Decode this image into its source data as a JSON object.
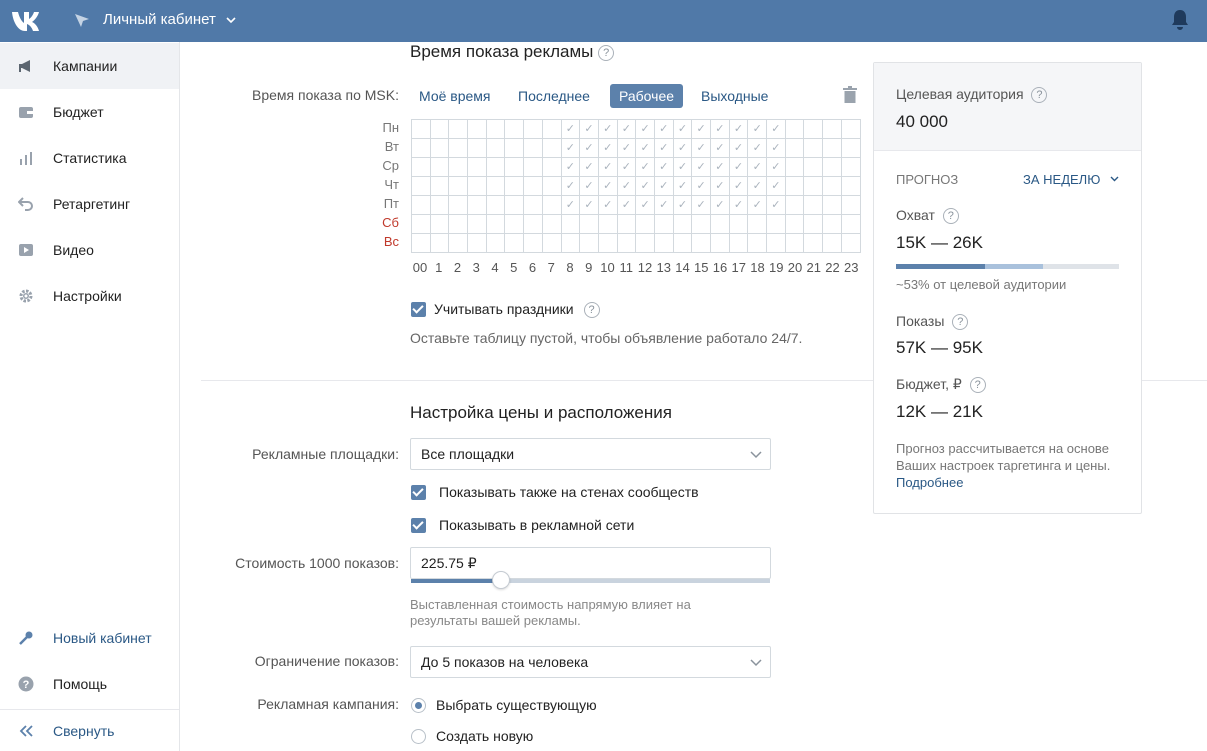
{
  "topbar": {
    "title": "Личный кабинет",
    "logo_icon": "vk-logo-icon",
    "bell_icon": "bell-icon",
    "color": "#5079a8"
  },
  "sidebar": {
    "items": [
      {
        "label": "Кампании",
        "icon": "megaphone-icon",
        "active": true
      },
      {
        "label": "Бюджет",
        "icon": "wallet-icon"
      },
      {
        "label": "Статистика",
        "icon": "bar-chart-icon"
      },
      {
        "label": "Ретаргетинг",
        "icon": "return-arrow-icon"
      },
      {
        "label": "Видео",
        "icon": "play-icon"
      },
      {
        "label": "Настройки",
        "icon": "gear-icon"
      }
    ],
    "bottom": [
      {
        "label": "Новый кабинет",
        "icon": "key-icon"
      },
      {
        "label": "Помощь",
        "icon": "help-icon"
      },
      {
        "label": "Свернуть",
        "icon": "collapse-icon"
      }
    ]
  },
  "schedule": {
    "title": "Время показа рекламы",
    "label": "Время показа по MSK:",
    "tabs": [
      "Моё время",
      "Последнее",
      "Рабочее",
      "Выходные"
    ],
    "active_tab": "Рабочее",
    "days": [
      "Пн",
      "Вт",
      "Ср",
      "Чт",
      "Пт",
      "Сб",
      "Вс"
    ],
    "hours": [
      "00",
      "1",
      "2",
      "3",
      "4",
      "5",
      "6",
      "7",
      "8",
      "9",
      "10",
      "11",
      "12",
      "13",
      "14",
      "15",
      "16",
      "17",
      "18",
      "19",
      "20",
      "21",
      "22",
      "23"
    ],
    "selected_days": [
      "Пн",
      "Вт",
      "Ср",
      "Чт",
      "Пт"
    ],
    "selected_hours": [
      "8",
      "9",
      "10",
      "11",
      "12",
      "13",
      "14",
      "15",
      "16",
      "17",
      "18",
      "19"
    ],
    "holidays_label": "Учитывать праздники",
    "hint": "Оставьте таблицу пустой, чтобы объявление работало 24/7."
  },
  "pricing": {
    "title": "Настройка цены и расположения",
    "platforms_label": "Рекламные площадки:",
    "platforms_value": "Все площадки",
    "show_walls": "Показывать также на стенах сообществ",
    "show_network": "Показывать в рекламной сети",
    "cost_label": "Стоимость 1000 показов:",
    "cost_value": "225.75 ₽",
    "cost_slider_fraction": 0.25,
    "cost_hint_1": "Выставленная стоимость напрямую влияет на",
    "cost_hint_2": "результаты вашей рекламы.",
    "limit_label": "Ограничение показов:",
    "limit_value": "До 5 показов на человека",
    "campaign_label": "Рекламная кампания:",
    "campaign_options": [
      "Выбрать существующую",
      "Создать новую"
    ],
    "campaign_selected": "Выбрать существующую"
  },
  "panel": {
    "audience_label": "Целевая аудитория",
    "audience_value": "40 000",
    "forecast_label": "ПРОГНОЗ",
    "period": "ЗА НЕДЕЛЮ",
    "reach_label": "Охват",
    "reach_value": "15K — 26K",
    "reach_bar_low": 0.4,
    "reach_bar_high": 0.66,
    "reach_note": "~53% от целевой аудитории",
    "impressions_label": "Показы",
    "impressions_value": "57K — 95K",
    "budget_label": "Бюджет, ₽",
    "budget_value": "12K — 21K",
    "note": "Прогноз рассчитывается на основе Ваших настроек таргетинга и цены.",
    "note_link": "Подробнее"
  }
}
